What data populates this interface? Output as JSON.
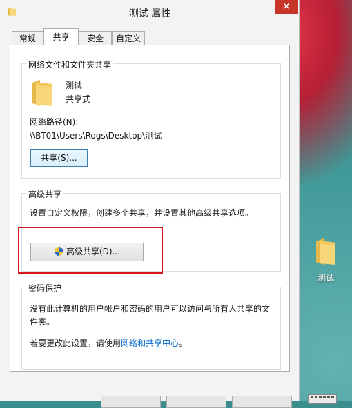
{
  "window": {
    "title": "测试 属性",
    "close_glyph": "✕"
  },
  "tabs": [
    {
      "label": "常规",
      "active": false
    },
    {
      "label": "共享",
      "active": true
    },
    {
      "label": "安全",
      "active": false
    },
    {
      "label": "自定义",
      "active": false
    }
  ],
  "network_sharing": {
    "group_title": "网络文件和文件夹共享",
    "folder_name": "测试",
    "status": "共享式",
    "path_label": "网络路径(N):",
    "path_value": "\\\\BT01\\Users\\Rogs\\Desktop\\测试",
    "share_button": "共享(S)..."
  },
  "advanced_sharing": {
    "group_title": "高级共享",
    "description": "设置自定义权限，创建多个共享，并设置其他高级共享选项。",
    "button": "高级共享(D)..."
  },
  "password_protection": {
    "group_title": "密码保护",
    "line1": "没有此计算机的用户帐户和密码的用户可以访问与所有人共享的文",
    "line2": "件夹。",
    "change_prefix": "若要更改此设置，请使用",
    "link": "网络和共享中心",
    "change_suffix": "。"
  },
  "desktop": {
    "icon_label": "测试"
  },
  "colors": {
    "close_red": "#c7352b",
    "highlight_red": "#d6141b",
    "link_blue": "#0066cc",
    "folder_yellow": "#f4d673"
  }
}
